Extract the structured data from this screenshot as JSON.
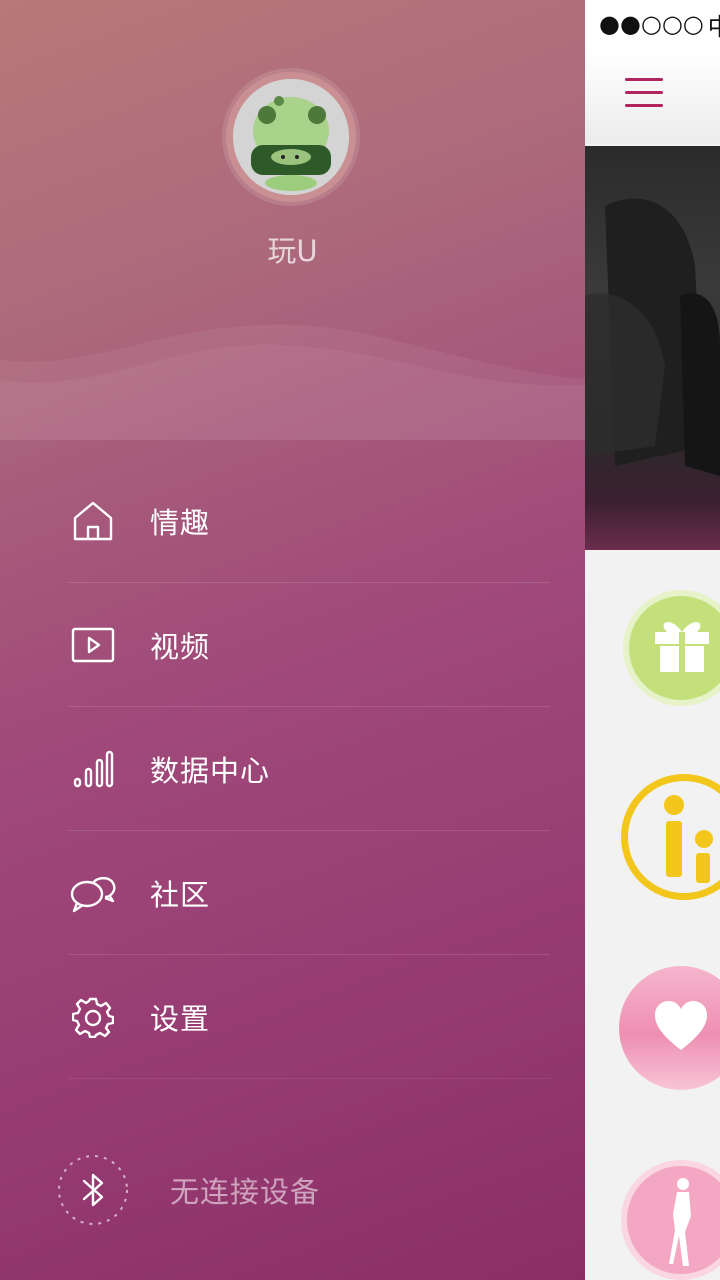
{
  "drawer": {
    "username": "玩U",
    "menu": [
      {
        "label": "情趣",
        "icon": "home-icon"
      },
      {
        "label": "视频",
        "icon": "video-icon"
      },
      {
        "label": "数据中心",
        "icon": "stats-bars-icon"
      },
      {
        "label": "社区",
        "icon": "chat-bubbles-icon"
      },
      {
        "label": "设置",
        "icon": "gear-icon"
      }
    ],
    "device_status": "无连接设备"
  },
  "status_bar": {
    "signal": "●●○○○",
    "carrier": "中国"
  },
  "colors": {
    "accent": "#b0245f",
    "drawer_top": "#b77878",
    "drawer_bottom": "#8b2e67"
  },
  "shortcuts": [
    {
      "icon": "gift-icon"
    },
    {
      "icon": "couple-icon"
    },
    {
      "icon": "heart-icon"
    },
    {
      "icon": "silhouette-icon"
    }
  ]
}
